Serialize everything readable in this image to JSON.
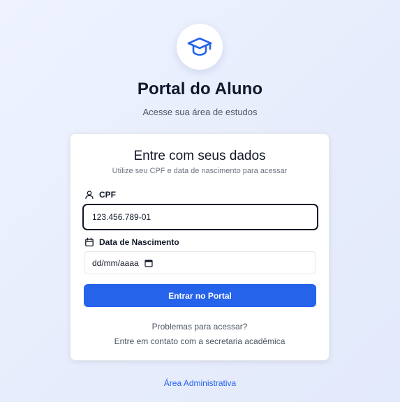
{
  "header": {
    "logo_icon": "graduation-cap-icon",
    "title": "Portal do Aluno",
    "subtitle": "Acesse sua área de estudos"
  },
  "login_card": {
    "title": "Entre com seus dados",
    "subtitle": "Utilize seu CPF e data de nascimento para acessar",
    "cpf": {
      "icon": "user-icon",
      "label": "CPF",
      "value": "123.456.789-01"
    },
    "birth_date": {
      "icon": "calendar-icon",
      "label": "Data de Nascimento",
      "placeholder": "dd/mm/aaaa"
    },
    "submit_label": "Entrar no Portal",
    "help_question": "Problemas para acessar?",
    "help_contact": "Entre em contato com a secretaria acadêmica"
  },
  "footer": {
    "admin_link": "Área Administrativa"
  },
  "colors": {
    "accent": "#2563eb",
    "title": "#0f172a",
    "background": "#e8eefc"
  }
}
